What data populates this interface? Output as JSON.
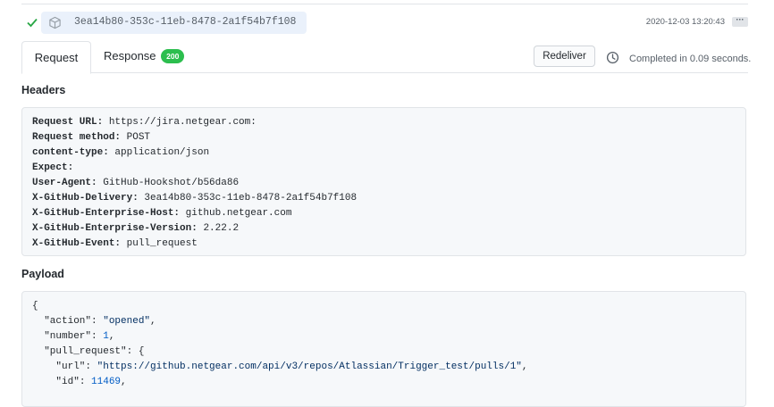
{
  "delivery": {
    "guid": "3ea14b80-353c-11eb-8478-2a1f54b7f108",
    "timestamp": "2020-12-03 13:20:43",
    "more_label": "···"
  },
  "tabs": {
    "request_label": "Request",
    "response_label": "Response",
    "response_status": "200"
  },
  "actions": {
    "redeliver_label": "Redeliver",
    "completed_text": "Completed in 0.09 seconds."
  },
  "headers": {
    "title": "Headers",
    "rows": [
      {
        "key": "Request URL:",
        "value": " https://jira.netgear.com:"
      },
      {
        "key": "Request method:",
        "value": " POST"
      },
      {
        "key": "content-type:",
        "value": " application/json"
      },
      {
        "key": "Expect:",
        "value": ""
      },
      {
        "key": "User-Agent:",
        "value": " GitHub-Hookshot/b56da86"
      },
      {
        "key": "X-GitHub-Delivery:",
        "value": " 3ea14b80-353c-11eb-8478-2a1f54b7f108"
      },
      {
        "key": "X-GitHub-Enterprise-Host:",
        "value": " github.netgear.com"
      },
      {
        "key": "X-GitHub-Enterprise-Version:",
        "value": " 2.22.2"
      },
      {
        "key": "X-GitHub-Event:",
        "value": " pull_request"
      }
    ]
  },
  "payload": {
    "title": "Payload",
    "lines": {
      "l0": "{",
      "l1_key": "  \"action\"",
      "l1_sep": ": ",
      "l1_val": "\"opened\"",
      "l1_end": ",",
      "l2_key": "  \"number\"",
      "l2_sep": ": ",
      "l2_val": "1",
      "l2_end": ",",
      "l3_key": "  \"pull_request\"",
      "l3_sep": ": {",
      "l4_key": "    \"url\"",
      "l4_sep": ": ",
      "l4_val": "\"https://github.netgear.com/api/v3/repos/Atlassian/Trigger_test/pulls/1\"",
      "l4_end": ",",
      "l5_key": "    \"id\"",
      "l5_sep": ": ",
      "l5_val": "11469",
      "l5_end": ","
    }
  },
  "colors": {
    "success_green": "#2cbe4e",
    "pill_bg": "#eaf1fb",
    "code_bg": "#f6f8fa"
  }
}
